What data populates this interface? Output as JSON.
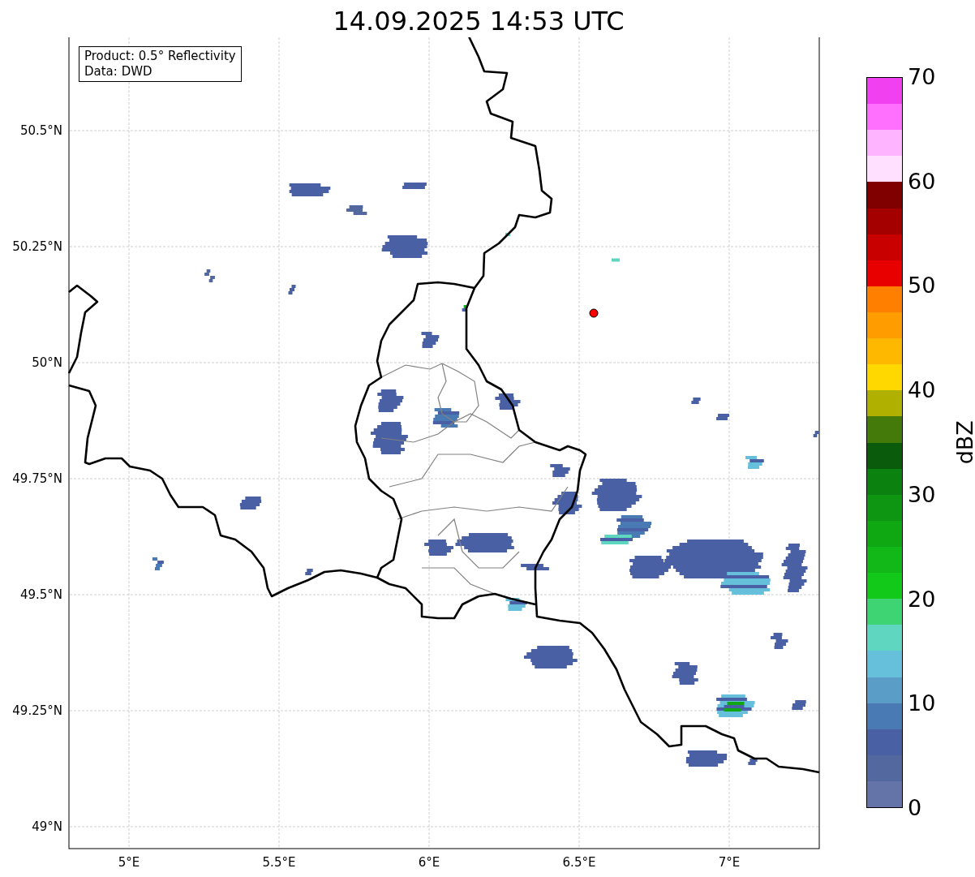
{
  "title": "14.09.2025 14:53 UTC",
  "legend": [
    "Product: 0.5° Reflectivity",
    "Data: DWD"
  ],
  "map": {
    "lat_labels": [
      "50.5°N",
      "50.25°N",
      "50°N",
      "49.75°N",
      "49.5°N",
      "49.25°N",
      "49°N"
    ],
    "lon_labels": [
      "5°E",
      "5.5°E",
      "6°E",
      "6.5°E",
      "7°E"
    ]
  },
  "colorbar": {
    "label": "dBZ",
    "ticks": [
      "70",
      "60",
      "50",
      "40",
      "30",
      "20",
      "10",
      "0"
    ],
    "bins": [
      {
        "color": "#f040f0"
      },
      {
        "color": "#ff70ff"
      },
      {
        "color": "#ffb4ff"
      },
      {
        "color": "#ffe0ff"
      },
      {
        "color": "#800000"
      },
      {
        "color": "#a40000"
      },
      {
        "color": "#c80000"
      },
      {
        "color": "#e80000"
      },
      {
        "color": "#ff8000"
      },
      {
        "color": "#ff9c00"
      },
      {
        "color": "#ffb800"
      },
      {
        "color": "#ffd800"
      },
      {
        "color": "#b0b000"
      },
      {
        "color": "#447a0a"
      },
      {
        "color": "#0a5c0c"
      },
      {
        "color": "#0b8210"
      },
      {
        "color": "#0e9612"
      },
      {
        "color": "#10a812"
      },
      {
        "color": "#12b818"
      },
      {
        "color": "#12c818"
      },
      {
        "color": "#3ed474"
      },
      {
        "color": "#5fd6c0"
      },
      {
        "color": "#66c0dc"
      },
      {
        "color": "#5a9ec8"
      },
      {
        "color": "#4a7ab4"
      },
      {
        "color": "#4a60a4"
      },
      {
        "color": "#5468a0"
      },
      {
        "color": "#6474a8"
      }
    ]
  }
}
